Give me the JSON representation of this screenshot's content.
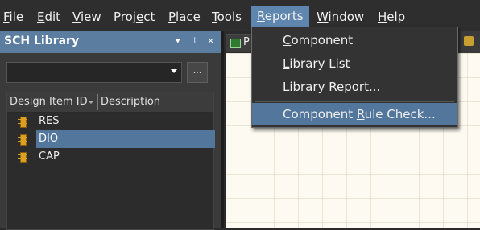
{
  "menubar": {
    "items": [
      {
        "pre": "",
        "u": "F",
        "post": "ile"
      },
      {
        "pre": "",
        "u": "E",
        "post": "dit"
      },
      {
        "pre": "",
        "u": "V",
        "post": "iew"
      },
      {
        "pre": "Proj",
        "u": "e",
        "post": "ct"
      },
      {
        "pre": "",
        "u": "P",
        "post": "lace"
      },
      {
        "pre": "",
        "u": "T",
        "post": "ools"
      },
      {
        "pre": "",
        "u": "R",
        "post": "eports"
      },
      {
        "pre": "",
        "u": "W",
        "post": "indow"
      },
      {
        "pre": "",
        "u": "H",
        "post": "elp"
      }
    ]
  },
  "panel": {
    "title": "SCH Library",
    "header_buttons": [
      "▾",
      "⊥",
      "×"
    ],
    "combo_value": "",
    "dots_label": "...",
    "columns": [
      "Design Item ID",
      "Description"
    ],
    "rows": [
      {
        "id": "RES",
        "selected": false
      },
      {
        "id": "DIO",
        "selected": true
      },
      {
        "id": "CAP",
        "selected": false
      }
    ]
  },
  "doc_tab": {
    "label": "P"
  },
  "reports_menu": {
    "items": [
      {
        "pre": "",
        "u": "C",
        "post": "omponent",
        "highlighted": false
      },
      {
        "pre": "",
        "u": "L",
        "post": "ibrary List",
        "highlighted": false
      },
      {
        "pre": "Library Rep",
        "u": "o",
        "post": "rt...",
        "highlighted": false
      },
      {
        "pre": "Component ",
        "u": "R",
        "post": "ule Check...",
        "highlighted": true
      }
    ]
  },
  "colors": {
    "accent": "#5f86ae",
    "panel_header": "#5a7da0",
    "selection": "#53779c",
    "canvas": "#fdfaf1"
  }
}
